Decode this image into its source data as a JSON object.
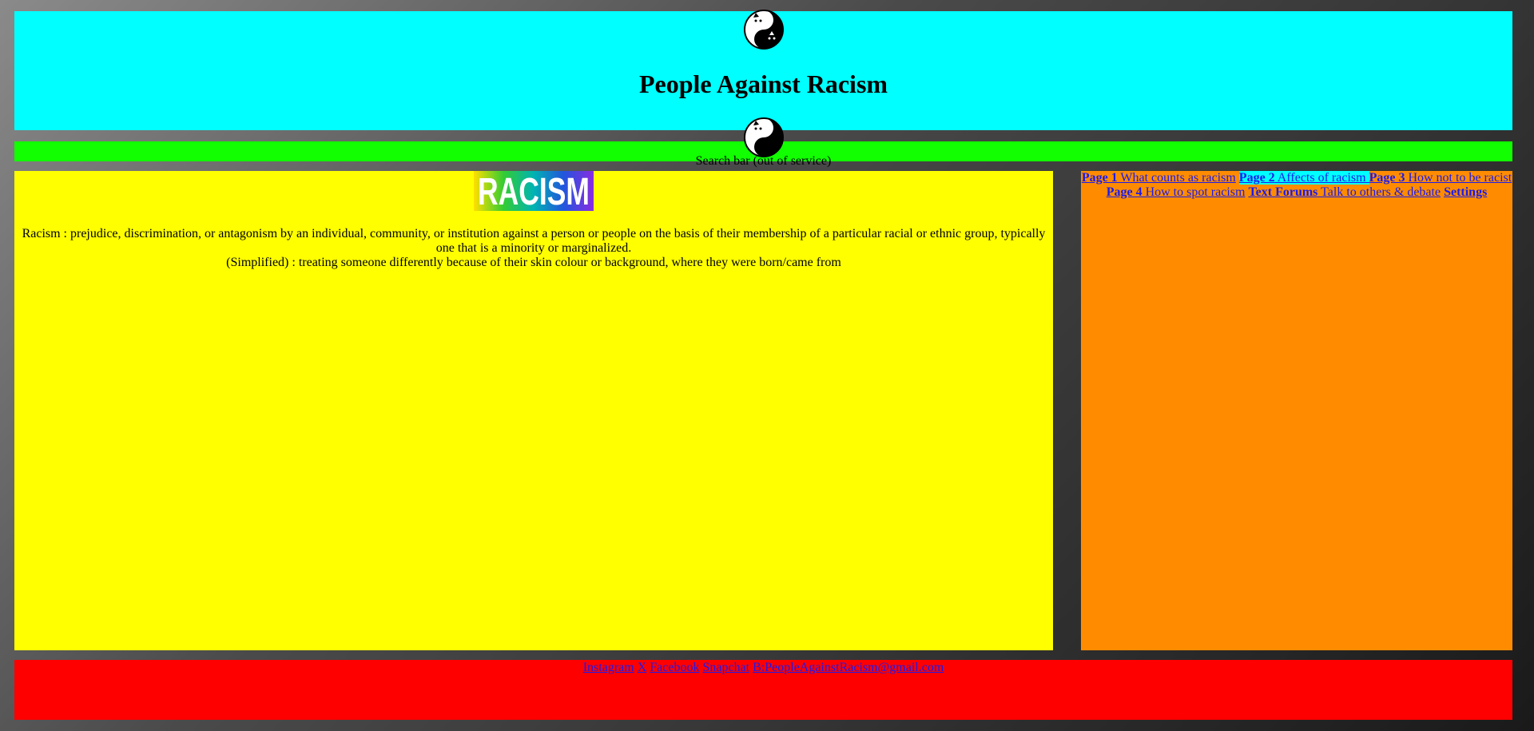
{
  "header": {
    "title": "People Against Racism",
    "logo_icon": "yin-yang-cats-icon"
  },
  "search": {
    "label": "Search bar (out of service)"
  },
  "main": {
    "banner_text": "RACISM",
    "definition": "Racism : prejudice, discrimination, or antagonism by an individual, community, or institution against a person or people on the basis of their membership of a particular racial or ethnic group, typically one that is a minority or marginalized.",
    "simplified": "(Simplified) : treating someone differently because of their skin colour or background, where they were born/came from"
  },
  "nav": {
    "items": [
      {
        "bold": "Page 1",
        "text": " What counts as racism"
      },
      {
        "bold": "Page 2",
        "text": " Affects of racism "
      },
      {
        "bold": "Page 3",
        "text": " How not to be racist"
      },
      {
        "bold": "Page 4",
        "text": " How to spot racism"
      },
      {
        "bold": "Text Forums",
        "text": " Talk to others & debate"
      },
      {
        "bold": "Settings",
        "text": ""
      }
    ]
  },
  "footer": {
    "links": [
      "Instagram",
      "X",
      "Facebook",
      "Snapchat",
      "B:PeopleAgainstRacism@gmail.com"
    ]
  },
  "colors": {
    "header_bg": "#00ffff",
    "search_bg": "#11ff00",
    "main_bg": "#ffff00",
    "aside_bg": "#ff8c00",
    "footer_bg": "#ff0000",
    "link": "#1a1aee"
  }
}
